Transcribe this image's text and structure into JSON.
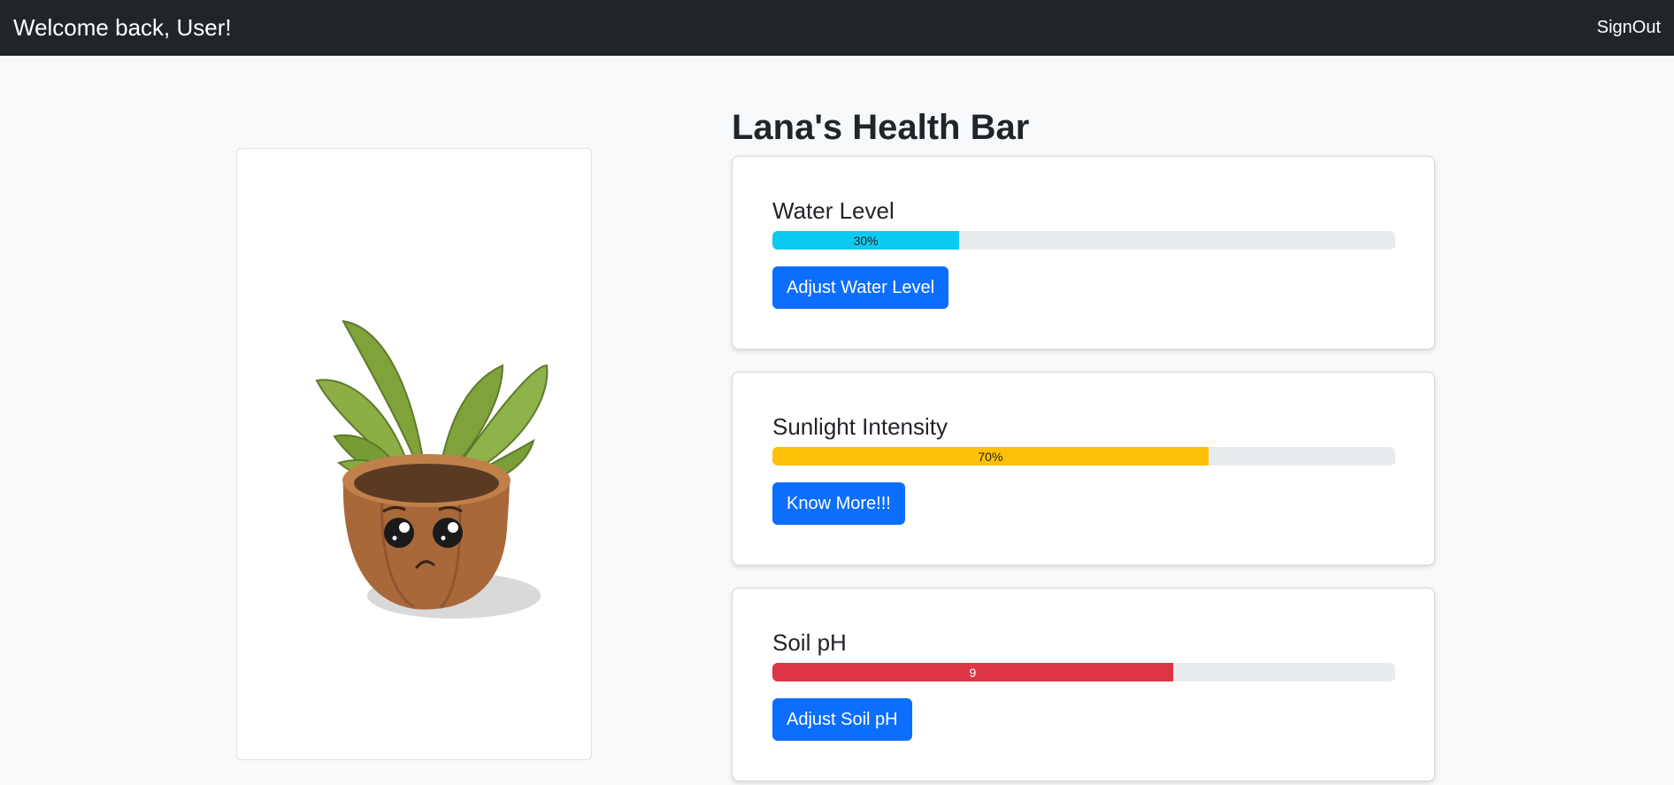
{
  "navbar": {
    "welcome": "Welcome back, User!",
    "signout": "SignOut"
  },
  "page": {
    "title": "Lana's Health Bar"
  },
  "stats": [
    {
      "title": "Water Level",
      "value_label": "30%",
      "fill_fraction": 0.3,
      "color": "#0dcaf0",
      "button": "Adjust Water Level"
    },
    {
      "title": "Sunlight Intensity",
      "value_label": "70%",
      "fill_fraction": 0.7,
      "color": "#ffc107",
      "button": "Know More!!!"
    },
    {
      "title": "Soil pH",
      "value_label": "9",
      "fill_fraction": 0.643,
      "color": "#dc3545",
      "button": "Adjust Soil pH"
    }
  ],
  "plant_image": {
    "icon": "sad-potted-plant-illustration"
  }
}
